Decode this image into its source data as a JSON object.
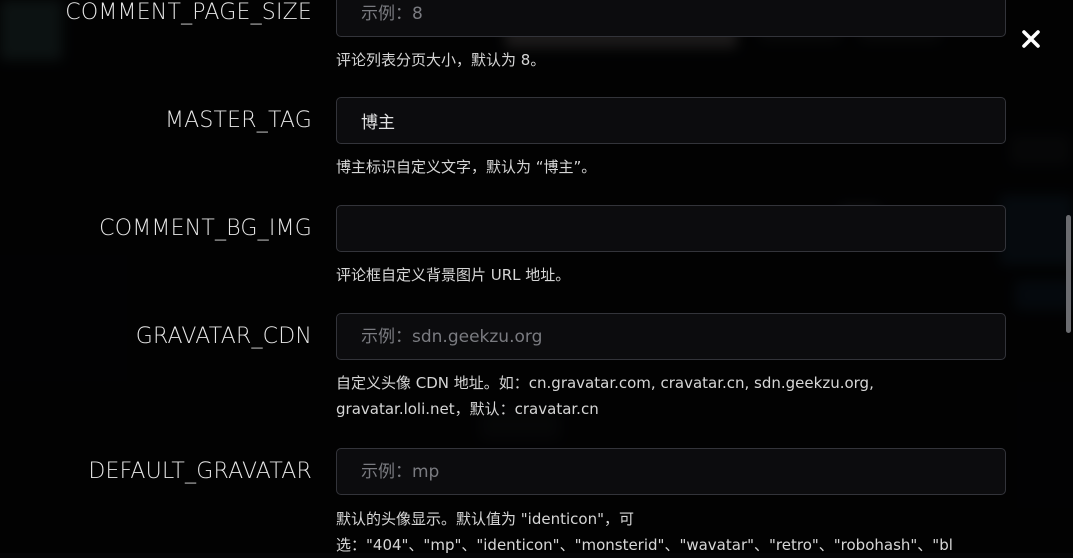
{
  "close_icon": "close-icon",
  "fields": [
    {
      "key": "comment_page_size",
      "label": "COMMENT_PAGE_SIZE",
      "value": "",
      "placeholder": "示例：8",
      "help": "评论列表分页大小，默认为 8。"
    },
    {
      "key": "master_tag",
      "label": "MASTER_TAG",
      "value": "博主",
      "placeholder": "",
      "help": "博主标识自定义文字，默认为 “博主”。"
    },
    {
      "key": "comment_bg_img",
      "label": "COMMENT_BG_IMG",
      "value": "",
      "placeholder": "",
      "help": "评论框自定义背景图片 URL 地址。"
    },
    {
      "key": "gravatar_cdn",
      "label": "GRAVATAR_CDN",
      "value": "",
      "placeholder": "示例：sdn.geekzu.org",
      "help_line1": "自定义头像 CDN 地址。如：cn.gravatar.com, cravatar.cn, sdn.geekzu.org,",
      "help_line2": "gravatar.loli.net，默认：cravatar.cn"
    },
    {
      "key": "default_gravatar",
      "label": "DEFAULT_GRAVATAR",
      "value": "",
      "placeholder": "示例：mp",
      "help_line1": "默认的头像显示。默认值为 \"identicon\"，可",
      "help_line2": "选：\"404\"、\"mp\"、\"identicon\"、\"monsterid\"、\"wavatar\"、\"retro\"、\"robohash\"、\"bl"
    }
  ]
}
